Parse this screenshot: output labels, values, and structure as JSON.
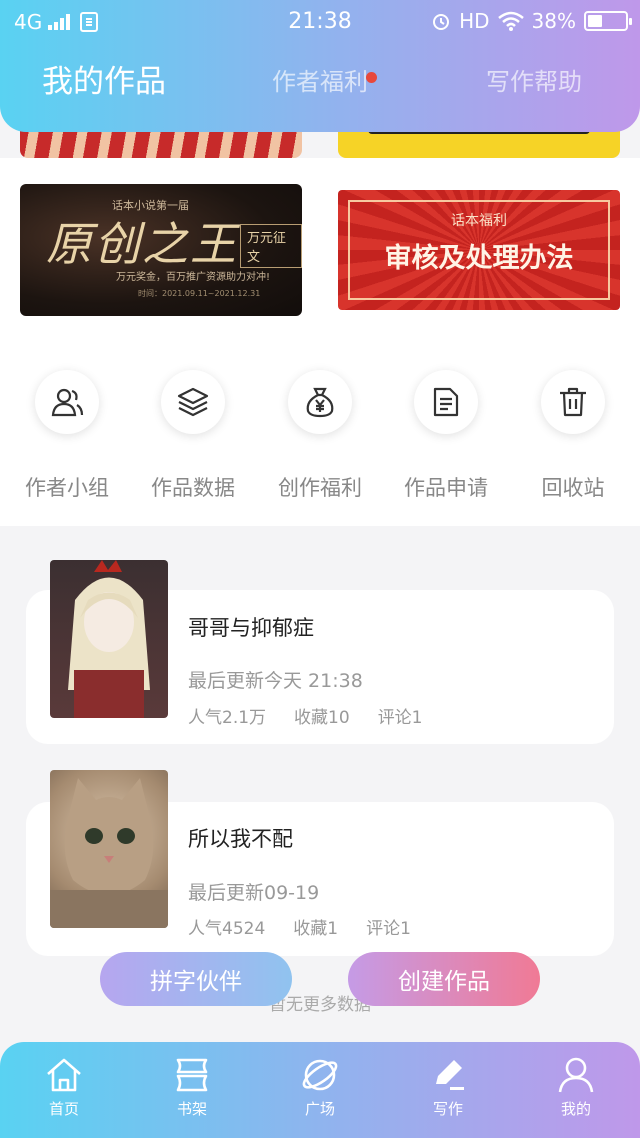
{
  "status_bar": {
    "network": "4G",
    "time": "21:38",
    "hd": "HD",
    "battery": "38%"
  },
  "header": {
    "tabs": [
      {
        "label": "我的作品",
        "active": true
      },
      {
        "label": "作者福利",
        "active": false,
        "dot": true
      },
      {
        "label": "写作帮助",
        "active": false
      }
    ]
  },
  "banners": {
    "left": {
      "top_text": "话本小说第一届",
      "title": "原创之王",
      "tag": "万元征文",
      "desc": "万元奖金，百万推广资源助力对冲!",
      "date": "时间：2021.09.11~2021.12.31"
    },
    "right": {
      "small": "话本福利",
      "title": "审核及处理办法"
    }
  },
  "shortcuts": [
    {
      "label": "作者小组",
      "icon": "group-icon"
    },
    {
      "label": "作品数据",
      "icon": "layers-icon"
    },
    {
      "label": "创作福利",
      "icon": "money-bag-icon"
    },
    {
      "label": "作品申请",
      "icon": "document-icon"
    },
    {
      "label": "回收站",
      "icon": "trash-icon"
    }
  ],
  "works": [
    {
      "title": "哥哥与抑郁症",
      "updated": "最后更新今天 21:38",
      "popularity": "人气2.1万",
      "favorites": "收藏10",
      "comments": "评论1"
    },
    {
      "title": "所以我不配",
      "updated": "最后更新09-19",
      "popularity": "人气4524",
      "favorites": "收藏1",
      "comments": "评论1"
    }
  ],
  "no_more": "暂无更多数据",
  "float_buttons": {
    "partner": "拼字伙伴",
    "create": "创建作品"
  },
  "nav": [
    {
      "label": "首页",
      "icon": "home-icon"
    },
    {
      "label": "书架",
      "icon": "bookshelf-icon"
    },
    {
      "label": "广场",
      "icon": "planet-icon"
    },
    {
      "label": "写作",
      "icon": "pen-icon"
    },
    {
      "label": "我的",
      "icon": "profile-icon"
    }
  ],
  "colors": {
    "gradient_start": "#59d2f2",
    "gradient_end": "#bf98ea",
    "dot": "#e8483c"
  }
}
